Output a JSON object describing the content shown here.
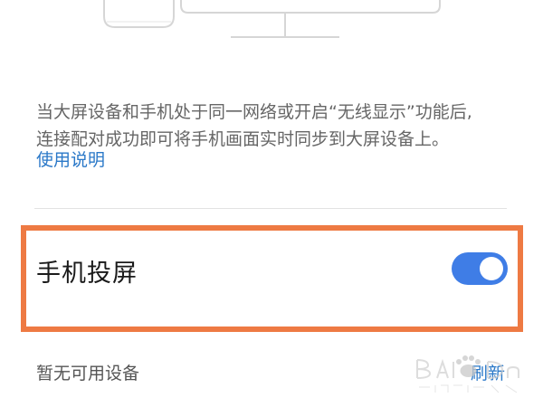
{
  "description": {
    "line1": "当大屏设备和手机处于同一网络或开启“无线显示”功能后,",
    "line2": "连接配对成功即可将手机画面实时同步到大屏设备上。"
  },
  "help_link": "使用说明",
  "screen_cast": {
    "label": "手机投屏",
    "enabled": true
  },
  "devices": {
    "empty_label": "暂无可用设备",
    "refresh_label": "刷新"
  },
  "colors": {
    "accent": "#2a78c8",
    "toggle_on": "#3f7de6",
    "highlight": "#ee7a43"
  },
  "icons": {
    "illustration": "phone-and-monitor-illustration",
    "watermark": "baidu-jingyan-watermark"
  }
}
